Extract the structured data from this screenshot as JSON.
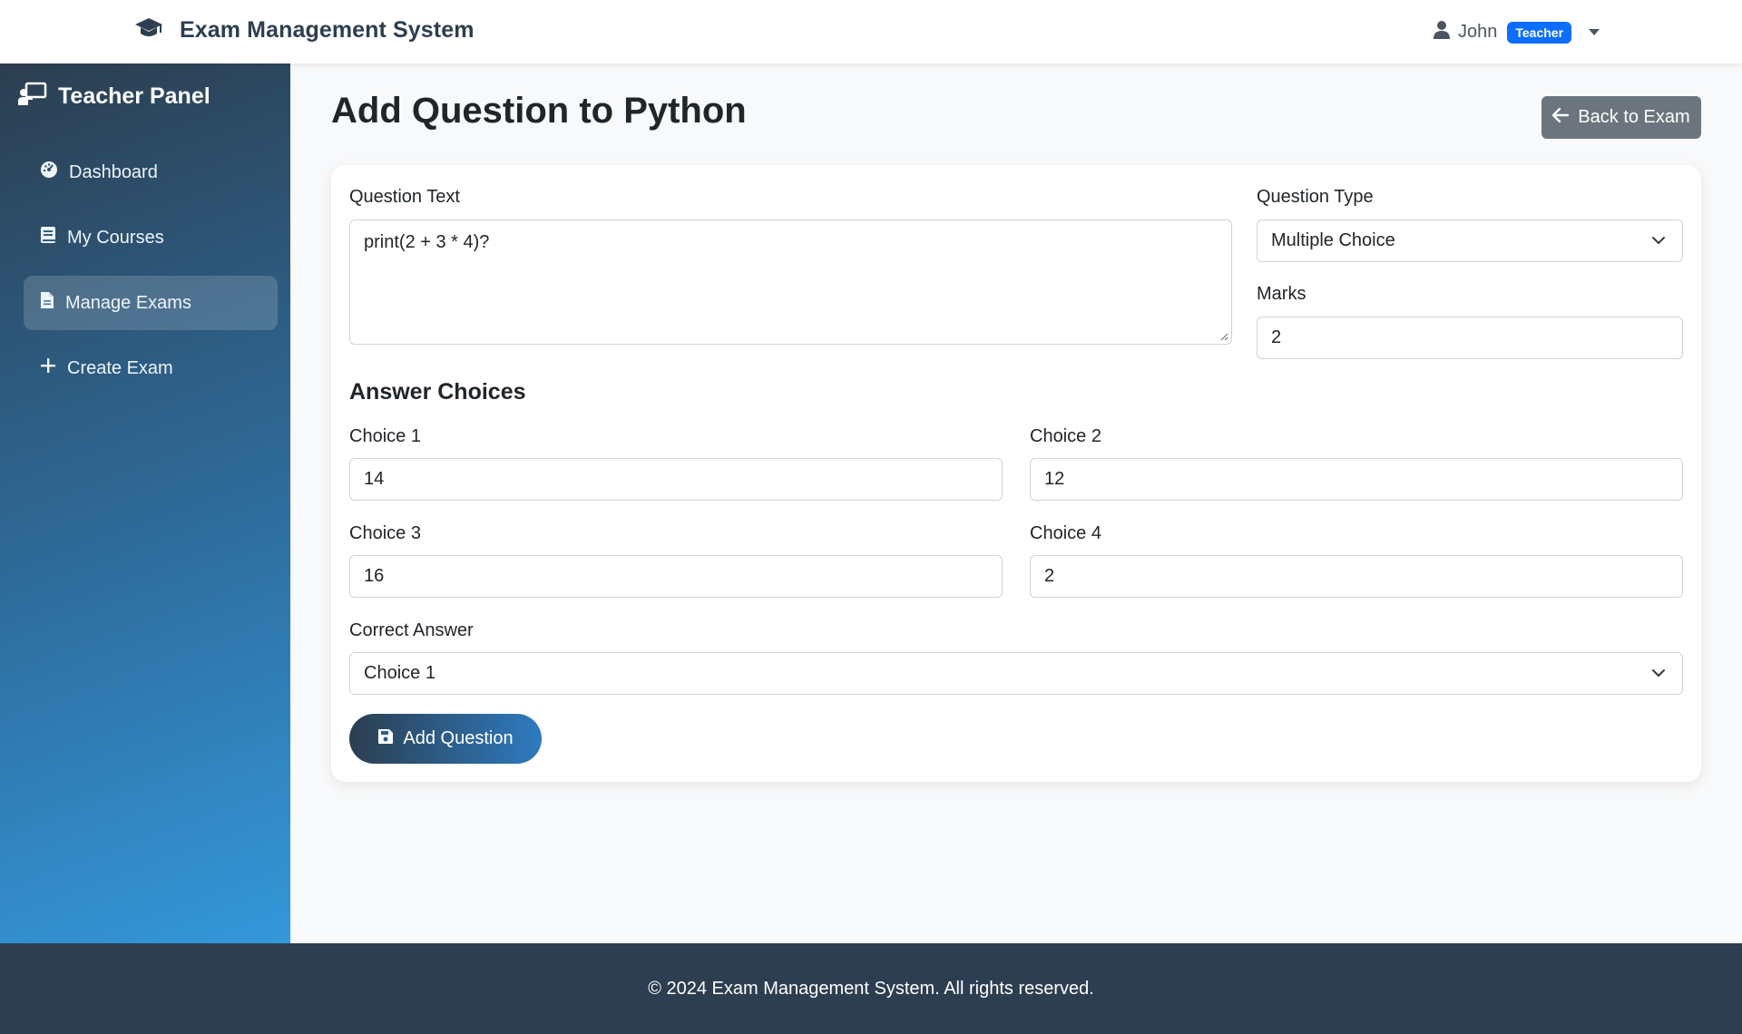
{
  "app": {
    "brand": "Exam Management System"
  },
  "user": {
    "name": "John",
    "role": "Teacher"
  },
  "sidebar": {
    "title": "Teacher Panel",
    "items": [
      {
        "label": "Dashboard",
        "icon": "dashboard-gauge-icon"
      },
      {
        "label": "My Courses",
        "icon": "book-icon"
      },
      {
        "label": "Manage Exams",
        "icon": "file-icon",
        "active": true
      },
      {
        "label": "Create Exam",
        "icon": "plus-icon"
      }
    ]
  },
  "page": {
    "title": "Add Question to Python",
    "back_label": "Back to Exam"
  },
  "form": {
    "question_text_label": "Question Text",
    "question_text": "print(2 + 3 * 4)?",
    "question_type_label": "Question Type",
    "question_type": "Multiple Choice",
    "marks_label": "Marks",
    "marks": "2",
    "answer_choices_title": "Answer Choices",
    "choices": [
      {
        "label": "Choice 1",
        "value": "14"
      },
      {
        "label": "Choice 2",
        "value": "12"
      },
      {
        "label": "Choice 3",
        "value": "16"
      },
      {
        "label": "Choice 4",
        "value": "2"
      }
    ],
    "correct_answer_label": "Correct Answer",
    "correct_answer": "Choice 1",
    "submit_label": "Add Question"
  },
  "footer": {
    "text": "© 2024 Exam Management System. All rights reserved."
  },
  "colors": {
    "primary_dark": "#2c3e50",
    "accent_blue": "#3498db",
    "badge_blue": "#0d6efd",
    "secondary": "#6c757d"
  }
}
